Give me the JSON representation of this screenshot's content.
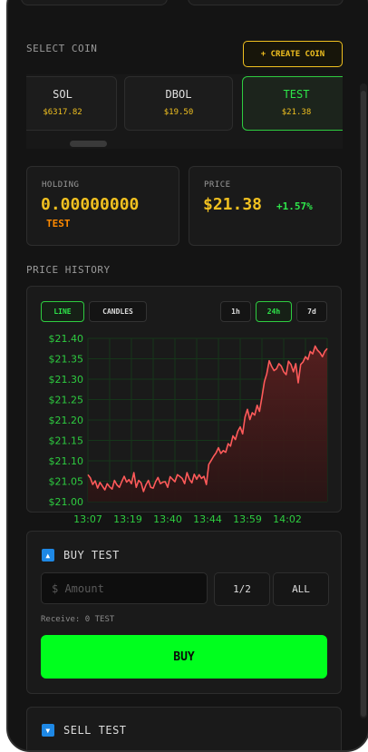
{
  "select_coin_label": "SELECT COIN",
  "create_coin_label": "+ CREATE COIN",
  "coins": [
    {
      "symbol": "SOL",
      "price": "$6317.82",
      "active": false
    },
    {
      "symbol": "DBOL",
      "price": "$19.50",
      "active": false
    },
    {
      "symbol": "TEST",
      "price": "$21.38",
      "active": true
    }
  ],
  "holding": {
    "label": "HOLDING",
    "value": "0.00000000",
    "unit": "TEST"
  },
  "price": {
    "label": "PRICE",
    "value": "$21.38",
    "change": "+1.57%"
  },
  "price_history_label": "PRICE HISTORY",
  "chart_controls": {
    "types": [
      {
        "label": "LINE",
        "active": true
      },
      {
        "label": "CANDLES",
        "active": false
      }
    ],
    "ranges": [
      {
        "label": "1h",
        "active": false
      },
      {
        "label": "24h",
        "active": true
      },
      {
        "label": "7d",
        "active": false
      }
    ]
  },
  "colors": {
    "accent_green": "#2ee64a",
    "gold": "#f0c020",
    "line_red": "#ff5a5a",
    "buy_green": "#00ff1e"
  },
  "chart_data": {
    "type": "area",
    "title": "",
    "xlabel": "",
    "ylabel": "",
    "x_tick_labels": [
      "13:07",
      "13:19",
      "13:40",
      "13:44",
      "13:59",
      "14:02"
    ],
    "y_tick_labels": [
      "$21.40",
      "$21.35",
      "$21.30",
      "$21.25",
      "$21.20",
      "$21.15",
      "$21.10",
      "$21.05",
      "$21.00"
    ],
    "ylim": [
      21.0,
      21.4
    ],
    "grid": true,
    "series": [
      {
        "values": [
          21.066,
          21.058,
          21.042,
          21.051,
          21.033,
          21.047,
          21.038,
          21.029,
          21.044,
          21.036,
          21.031,
          21.052,
          21.041,
          21.035,
          21.049,
          21.062,
          21.048,
          21.054,
          21.044,
          21.071,
          21.035,
          21.052,
          21.046,
          21.025,
          21.041,
          21.052,
          21.035,
          21.033,
          21.049,
          21.059,
          21.044,
          21.048,
          21.049,
          21.035,
          21.061,
          21.055,
          21.049,
          21.066,
          21.062,
          21.057,
          21.044,
          21.071,
          21.055,
          21.046,
          21.067,
          21.055,
          21.066,
          21.057,
          21.062,
          21.042,
          21.091,
          21.101,
          21.111,
          21.119,
          21.132,
          21.118,
          21.125,
          21.121,
          21.142,
          21.136,
          21.161,
          21.152,
          21.172,
          21.183,
          21.166,
          21.207,
          21.226,
          21.201,
          21.218,
          21.212,
          21.236,
          21.221,
          21.256,
          21.294,
          21.313,
          21.345,
          21.331,
          21.321,
          21.325,
          21.338,
          21.332,
          21.318,
          21.311,
          21.344,
          21.336,
          21.318,
          21.338,
          21.291,
          21.336,
          21.342,
          21.355,
          21.348,
          21.368,
          21.362,
          21.381,
          21.371,
          21.365,
          21.355,
          21.368,
          21.375
        ]
      }
    ]
  },
  "buy": {
    "title": "BUY TEST",
    "placeholder": "$ Amount",
    "half": "1/2",
    "all": "ALL",
    "receive": "Receive: 0 TEST",
    "button": "BUY"
  },
  "sell": {
    "title": "SELL TEST"
  }
}
